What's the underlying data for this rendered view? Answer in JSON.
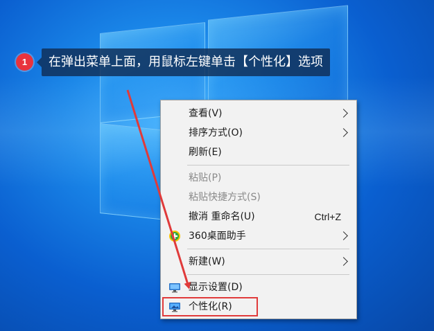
{
  "annotation": {
    "step_number": "1",
    "instruction": "在弹出菜单上面，用鼠标左键单击【个性化】选项"
  },
  "context_menu": {
    "items": [
      {
        "label": "查看(V)",
        "submenu": true,
        "icon": null
      },
      {
        "label": "排序方式(O)",
        "submenu": true,
        "icon": null
      },
      {
        "label": "刷新(E)",
        "submenu": false,
        "icon": null
      },
      {
        "label": "粘贴(P)",
        "disabled": true
      },
      {
        "label": "粘贴快捷方式(S)",
        "disabled": true
      },
      {
        "label": "撤消 重命名(U)",
        "shortcut": "Ctrl+Z"
      },
      {
        "label": "360桌面助手",
        "submenu": true,
        "icon": "360-assistant-icon"
      },
      {
        "label": "新建(W)",
        "submenu": true
      },
      {
        "label": "显示设置(D)",
        "icon": "display-settings-icon"
      },
      {
        "label": "个性化(R)",
        "icon": "personalize-icon",
        "highlighted": true
      }
    ]
  },
  "colors": {
    "badge": "#e8333d",
    "highlight_border": "#e03a3a",
    "arrow": "#e03a3a",
    "desktop": "#0a5fd0"
  }
}
